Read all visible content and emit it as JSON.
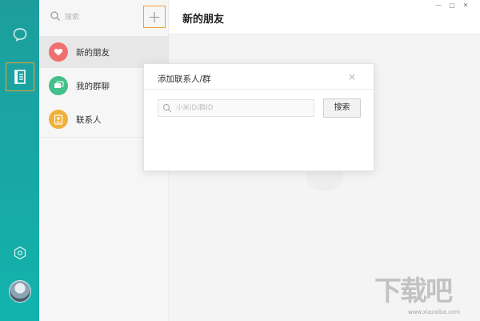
{
  "sidebar": {
    "nav": [
      {
        "name": "chat",
        "icon": "chat-bubble-icon"
      },
      {
        "name": "contacts",
        "icon": "address-book-icon",
        "selected": true
      },
      {
        "name": "settings",
        "icon": "hexagon-settings-icon"
      }
    ],
    "accent_color": "#1aa6a2"
  },
  "list": {
    "search_placeholder": "搜索",
    "add_label": "+",
    "items": [
      {
        "label": "新的朋友",
        "icon": "heart-icon",
        "color": "#ef6f6f",
        "active": true
      },
      {
        "label": "我的群聊",
        "icon": "group-chat-icon",
        "color": "#44c08a"
      },
      {
        "label": "联系人",
        "icon": "contact-card-icon",
        "color": "#f0b13a"
      }
    ]
  },
  "main": {
    "title": "新的朋友",
    "window_controls": {
      "minimize": "—",
      "maximize": "□",
      "close": "✕"
    }
  },
  "dialog": {
    "title": "添加联系人/群",
    "close": "×",
    "input_placeholder": "小米ID/群ID",
    "search_button": "搜索"
  },
  "watermark": {
    "mark": "下载吧",
    "url": "www.xiazaiba.com"
  }
}
